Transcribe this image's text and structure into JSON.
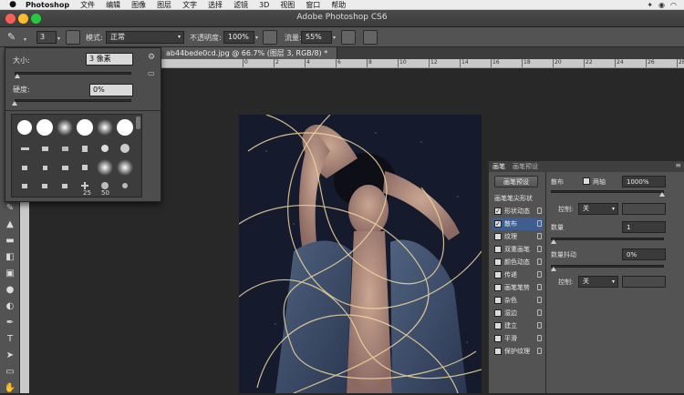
{
  "menubar": {
    "app": "Photoshop",
    "items": [
      "文件",
      "编辑",
      "图像",
      "图层",
      "文字",
      "选择",
      "滤镜",
      "3D",
      "视图",
      "窗口",
      "帮助"
    ]
  },
  "window": {
    "title": "Adobe Photoshop CS6"
  },
  "options": {
    "brush_size": "3",
    "mode_label": "模式:",
    "mode_value": "正常",
    "opacity_label": "不透明度:",
    "opacity_value": "100%",
    "flow_label": "流量:",
    "flow_value": "55%"
  },
  "document": {
    "tab": "ab44bede0cd.jpg @ 66.7% (图层 3, RGB/8) *"
  },
  "brush_picker": {
    "size_label": "大小:",
    "size_value": "3 像素",
    "hardness_label": "硬度:",
    "hardness_value": "0%",
    "size_level": 0.02,
    "hardness_level": 0.0,
    "tip_numbers": [
      "25",
      "50"
    ]
  },
  "brush_panel": {
    "tabs": [
      "画笔",
      "画笔预设"
    ],
    "preset_button": "画笔预设",
    "section_label": "画笔笔尖形状",
    "items": [
      {
        "label": "形状动态",
        "checked": true
      },
      {
        "label": "散布",
        "checked": true
      },
      {
        "label": "纹理",
        "checked": false
      },
      {
        "label": "双重画笔",
        "checked": false
      },
      {
        "label": "颜色动态",
        "checked": false
      },
      {
        "label": "传递",
        "checked": false
      },
      {
        "label": "画笔笔势",
        "checked": false
      },
      {
        "label": "杂色",
        "checked": false
      },
      {
        "label": "湿边",
        "checked": false
      },
      {
        "label": "建立",
        "checked": false
      },
      {
        "label": "平滑",
        "checked": false
      },
      {
        "label": "保护纹理",
        "checked": false
      }
    ],
    "scatter_label": "散布",
    "both_axes_label": "两轴",
    "scatter_value": "1000%",
    "control_label": "控制:",
    "control_value": "关",
    "count_label": "数量",
    "count_value": "1",
    "count_jitter_label": "数量抖动",
    "count_jitter_value": "0%",
    "control2_label": "控制:",
    "control2_value": "关"
  },
  "ruler_ticks": [
    "0",
    "2",
    "4",
    "6",
    "8",
    "10",
    "12",
    "14",
    "16",
    "18",
    "20",
    "22",
    "24",
    "26",
    "28",
    "30"
  ],
  "colors": {
    "accent": "#3e5e8f",
    "panel": "#535353",
    "dark": "#282828"
  }
}
